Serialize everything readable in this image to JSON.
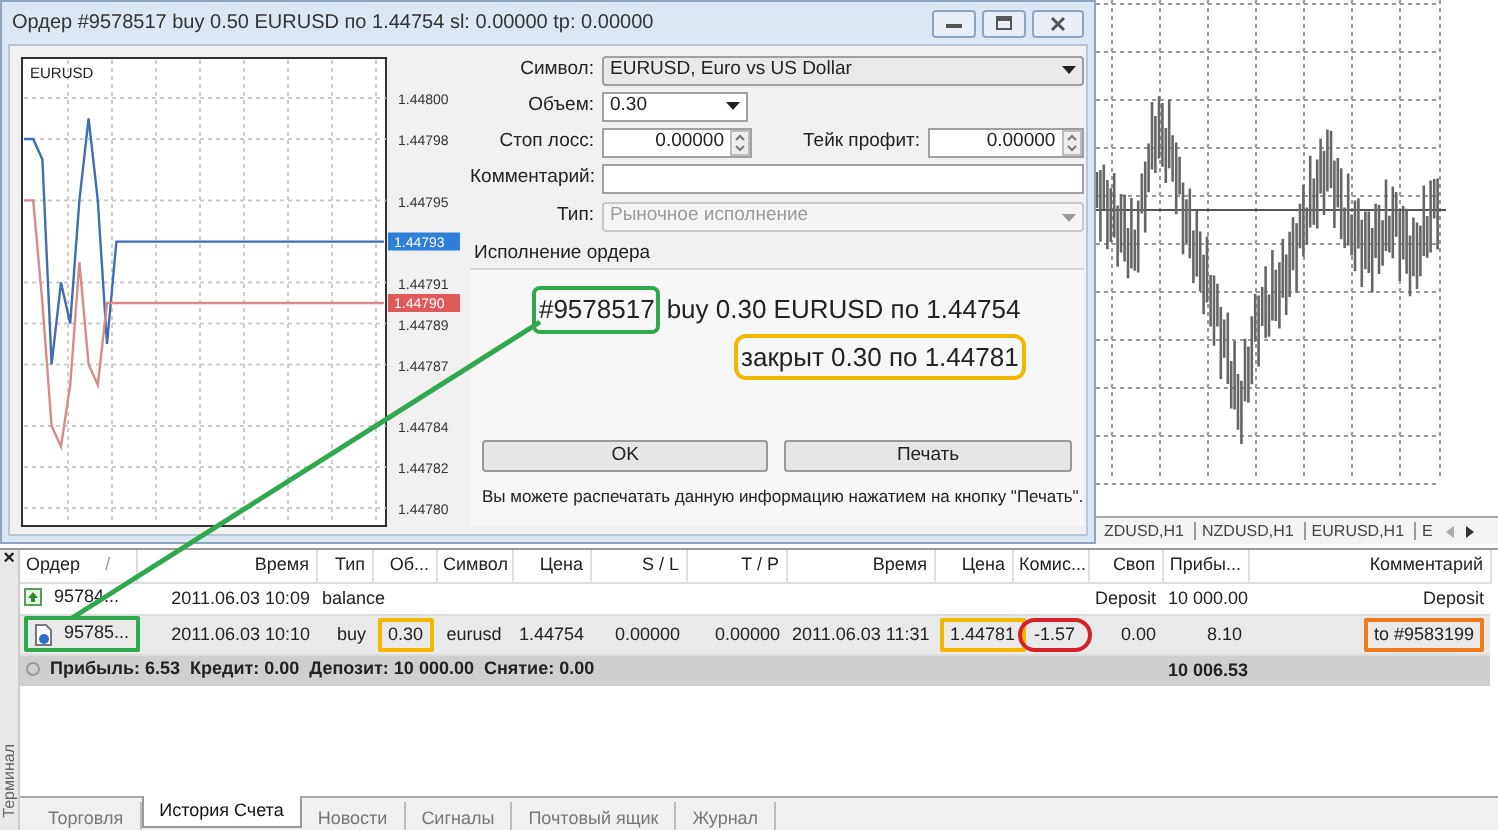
{
  "dialog": {
    "title": "Ордер #9578517 buy 0.50 EURUSD по 1.44754 sl: 0.00000 tp: 0.00000",
    "chart": {
      "label": "EURUSD",
      "chart_data": {
        "type": "line",
        "grid": true,
        "series": [
          {
            "color": "#3f6fb0",
            "values": [
              1.44798,
              1.44798,
              1.44797,
              1.44787,
              1.44791,
              1.44789,
              1.44795,
              1.44799,
              1.44795,
              1.44788,
              1.44793,
              1.44793,
              1.44793,
              1.44793,
              1.44793,
              1.44793,
              1.44793,
              1.44793,
              1.44793,
              1.44793,
              1.44793,
              1.44793,
              1.44793,
              1.44793,
              1.44793,
              1.44793,
              1.44793,
              1.44793,
              1.44793,
              1.44793,
              1.44793,
              1.44793,
              1.44793,
              1.44793,
              1.44793,
              1.44793,
              1.44793,
              1.44793,
              1.44793,
              1.44793
            ]
          },
          {
            "color": "#d98a8a",
            "values": [
              1.44795,
              1.44795,
              1.4479,
              1.44784,
              1.44783,
              1.44786,
              1.44792,
              1.44787,
              1.44786,
              1.4479,
              1.4479,
              1.4479,
              1.4479,
              1.4479,
              1.4479,
              1.4479,
              1.4479,
              1.4479,
              1.4479,
              1.4479,
              1.4479,
              1.4479,
              1.4479,
              1.4479,
              1.4479,
              1.4479,
              1.4479,
              1.4479,
              1.4479,
              1.4479,
              1.4479,
              1.4479,
              1.4479,
              1.4479,
              1.4479,
              1.4479,
              1.4479,
              1.4479,
              1.4479,
              1.4479
            ]
          }
        ],
        "ylim": [
          1.4478,
          1.448
        ],
        "yticks": [
          {
            "value": 1.448,
            "label": "1.44800"
          },
          {
            "value": 1.44798,
            "label": "1.44798"
          },
          {
            "value": 1.44795,
            "label": "1.44795"
          },
          {
            "value": 1.44791,
            "label": "1.44791"
          },
          {
            "value": 1.44789,
            "label": "1.44789"
          },
          {
            "value": 1.44787,
            "label": "1.44787"
          },
          {
            "value": 1.44784,
            "label": "1.44784"
          },
          {
            "value": 1.44782,
            "label": "1.44782"
          },
          {
            "value": 1.4478,
            "label": "1.44780"
          }
        ]
      },
      "price_markers": [
        {
          "label": "1.44793",
          "color": "#2f7fd8"
        },
        {
          "label": "1.44790",
          "color": "#e05a5a"
        }
      ]
    },
    "symbol": {
      "label": "Символ:",
      "value": "EURUSD, Euro vs US Dollar"
    },
    "volume": {
      "label": "Объем:",
      "value": "0.30"
    },
    "stop_loss": {
      "label": "Стоп лосс:",
      "value": "0.00000"
    },
    "take_profit": {
      "label": "Тейк профит:",
      "value": "0.00000"
    },
    "comment": {
      "label": "Комментарий:"
    },
    "order_type": {
      "label": "Тип:",
      "value": "Рыночное исполнение",
      "disabled": true
    },
    "execution": {
      "title": "Исполнение ордера",
      "order_number": {
        "text": "#9578517",
        "color": "#2fa84f"
      },
      "order_text": "buy 0.30 EURUSD по 1.44754",
      "close_text": {
        "text": "закрыт 0.30 по 1.44781",
        "color": "#f2b800"
      },
      "buttons": [
        "OK",
        "Печать"
      ],
      "note": "Вы можете распечатать данную информацию нажатием на кнопку \"Печать\"."
    }
  },
  "chart_tabs": [
    "ZDUSD,H1",
    "NZDUSD,H1",
    "EURUSD,H1",
    "E"
  ],
  "terminal": {
    "title": "Терминал",
    "close": "×",
    "columns": [
      {
        "label": "Ордер",
        "sort_mark": "/"
      },
      {
        "label": "Время"
      },
      {
        "label": "Тип"
      },
      {
        "label": "Об..."
      },
      {
        "label": "Символ"
      },
      {
        "label": "Цена"
      },
      {
        "label": "S / L"
      },
      {
        "label": "T / P"
      },
      {
        "label": "Время"
      },
      {
        "label": "Цена"
      },
      {
        "label": "Комис..."
      },
      {
        "label": "Своп"
      },
      {
        "label": "Прибы..."
      },
      {
        "label": "Комментарий"
      }
    ],
    "rows": [
      {
        "kind": "deposit",
        "selected": false,
        "cells": [
          "95784...",
          "2011.06.03 10:09",
          "balance",
          null,
          null,
          null,
          null,
          null,
          null,
          null,
          null,
          "Deposit",
          "10 000.00",
          "Deposit"
        ]
      },
      {
        "kind": "order",
        "selected": true,
        "cells": [
          {
            "text": "95785...",
            "color": "#2fa84f",
            "kind": "box"
          },
          "2011.06.03 10:10",
          "buy",
          {
            "text": "0.30",
            "color": "#f2b800",
            "kind": "box"
          },
          "eurusd",
          "1.44754",
          "0.00000",
          "0.00000",
          "2011.06.03 11:31",
          {
            "text": "1.44781",
            "color": "#f2b800",
            "kind": "box"
          },
          {
            "text": "-1.57",
            "color": "#d8202a",
            "kind": "ellipse"
          },
          "0.00",
          "8.10",
          {
            "text": "to #9583199",
            "color": "#f07a1a",
            "kind": "box"
          }
        ]
      }
    ],
    "summary": {
      "text": "Прибыль: 6.53  Кредит: 0.00  Депозит: 10 000.00  Снятие: 0.00",
      "total": "10 006.53"
    },
    "tabs": [
      {
        "label": "Торговля",
        "selected": false
      },
      {
        "label": "История Счета",
        "selected": true
      },
      {
        "label": "Новости",
        "selected": false
      },
      {
        "label": "Сигналы",
        "selected": false
      },
      {
        "label": "Почтовый ящик",
        "selected": false
      },
      {
        "label": "Журнал",
        "selected": false
      }
    ]
  }
}
